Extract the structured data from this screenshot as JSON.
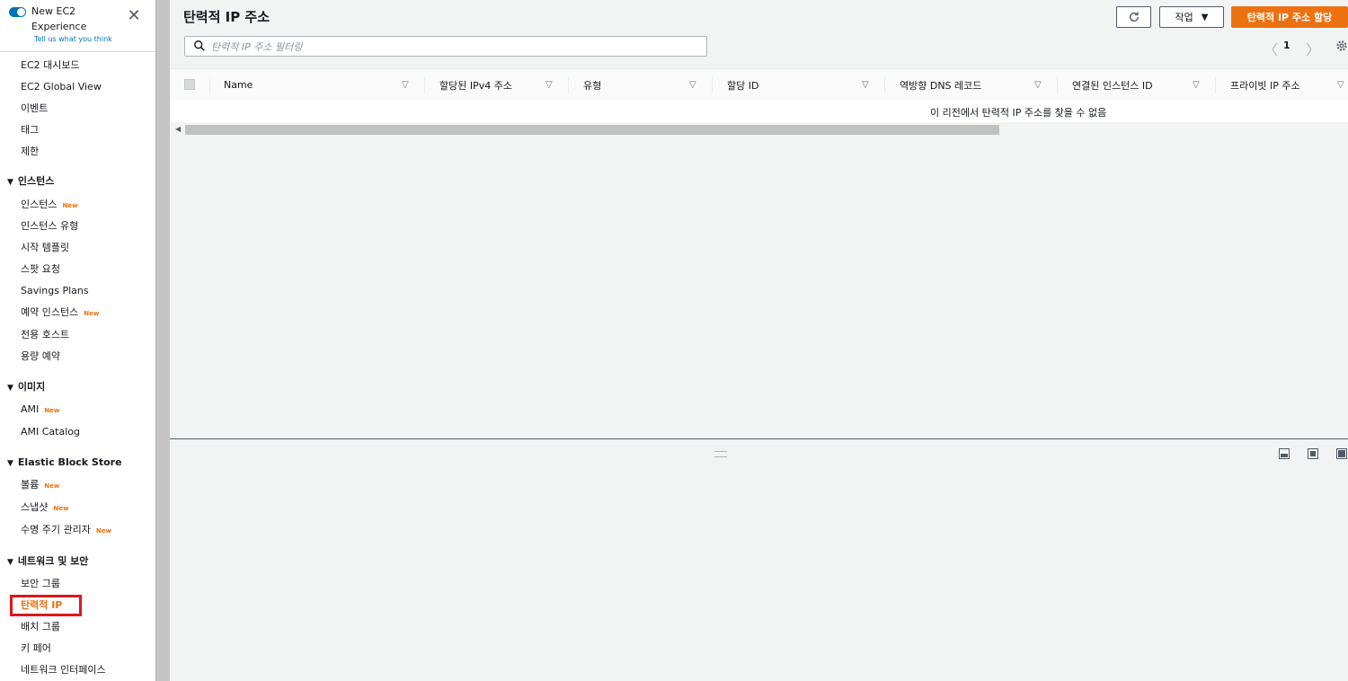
{
  "sidebar": {
    "experience_title": "New EC2 Experience",
    "experience_link": "Tell us what you think",
    "close_glyph": "✕",
    "new_badge": "New",
    "items": [
      {
        "label": "EC2 대시보드"
      },
      {
        "label": "EC2 Global View"
      },
      {
        "label": "이벤트"
      },
      {
        "label": "태그"
      },
      {
        "label": "제한"
      }
    ],
    "sections": [
      {
        "title": "인스턴스",
        "items": [
          {
            "label": "인스턴스",
            "new": true
          },
          {
            "label": "인스턴스 유형"
          },
          {
            "label": "시작 템플릿"
          },
          {
            "label": "스팟 요청"
          },
          {
            "label": "Savings Plans"
          },
          {
            "label": "예약 인스턴스",
            "new": true
          },
          {
            "label": "전용 호스트"
          },
          {
            "label": "용량 예약"
          }
        ]
      },
      {
        "title": "이미지",
        "items": [
          {
            "label": "AMI",
            "new": true
          },
          {
            "label": "AMI Catalog"
          }
        ]
      },
      {
        "title": "Elastic Block Store",
        "items": [
          {
            "label": "볼륨",
            "new": true
          },
          {
            "label": "스냅샷",
            "new": true
          },
          {
            "label": "수명 주기 관리자",
            "new": true
          }
        ]
      },
      {
        "title": "네트워크 및 보안",
        "items": [
          {
            "label": "보안 그룹"
          },
          {
            "label": "탄력적 IP",
            "active": true
          },
          {
            "label": "배치 그룹"
          },
          {
            "label": "키 페어"
          },
          {
            "label": "네트워크 인터페이스"
          }
        ]
      }
    ]
  },
  "header": {
    "title": "탄력적 IP 주소",
    "actions_label": "작업",
    "primary_label": "탄력적 IP 주소 할당"
  },
  "search": {
    "placeholder": "탄력적 IP 주소 필터링"
  },
  "pagination": {
    "current_page": "1"
  },
  "table": {
    "columns": [
      "Name",
      "할당된 IPv4 주소",
      "유형",
      "할당 ID",
      "역방향 DNS 레코드",
      "연결된 인스턴스 ID",
      "프라이빗 IP 주소"
    ],
    "empty_message": "이 리전에서 탄력적 IP 주소를 찾을 수 없음"
  },
  "colors": {
    "accent": "#ec7211",
    "link": "#0073bb",
    "highlight_box": "#e0161b"
  }
}
